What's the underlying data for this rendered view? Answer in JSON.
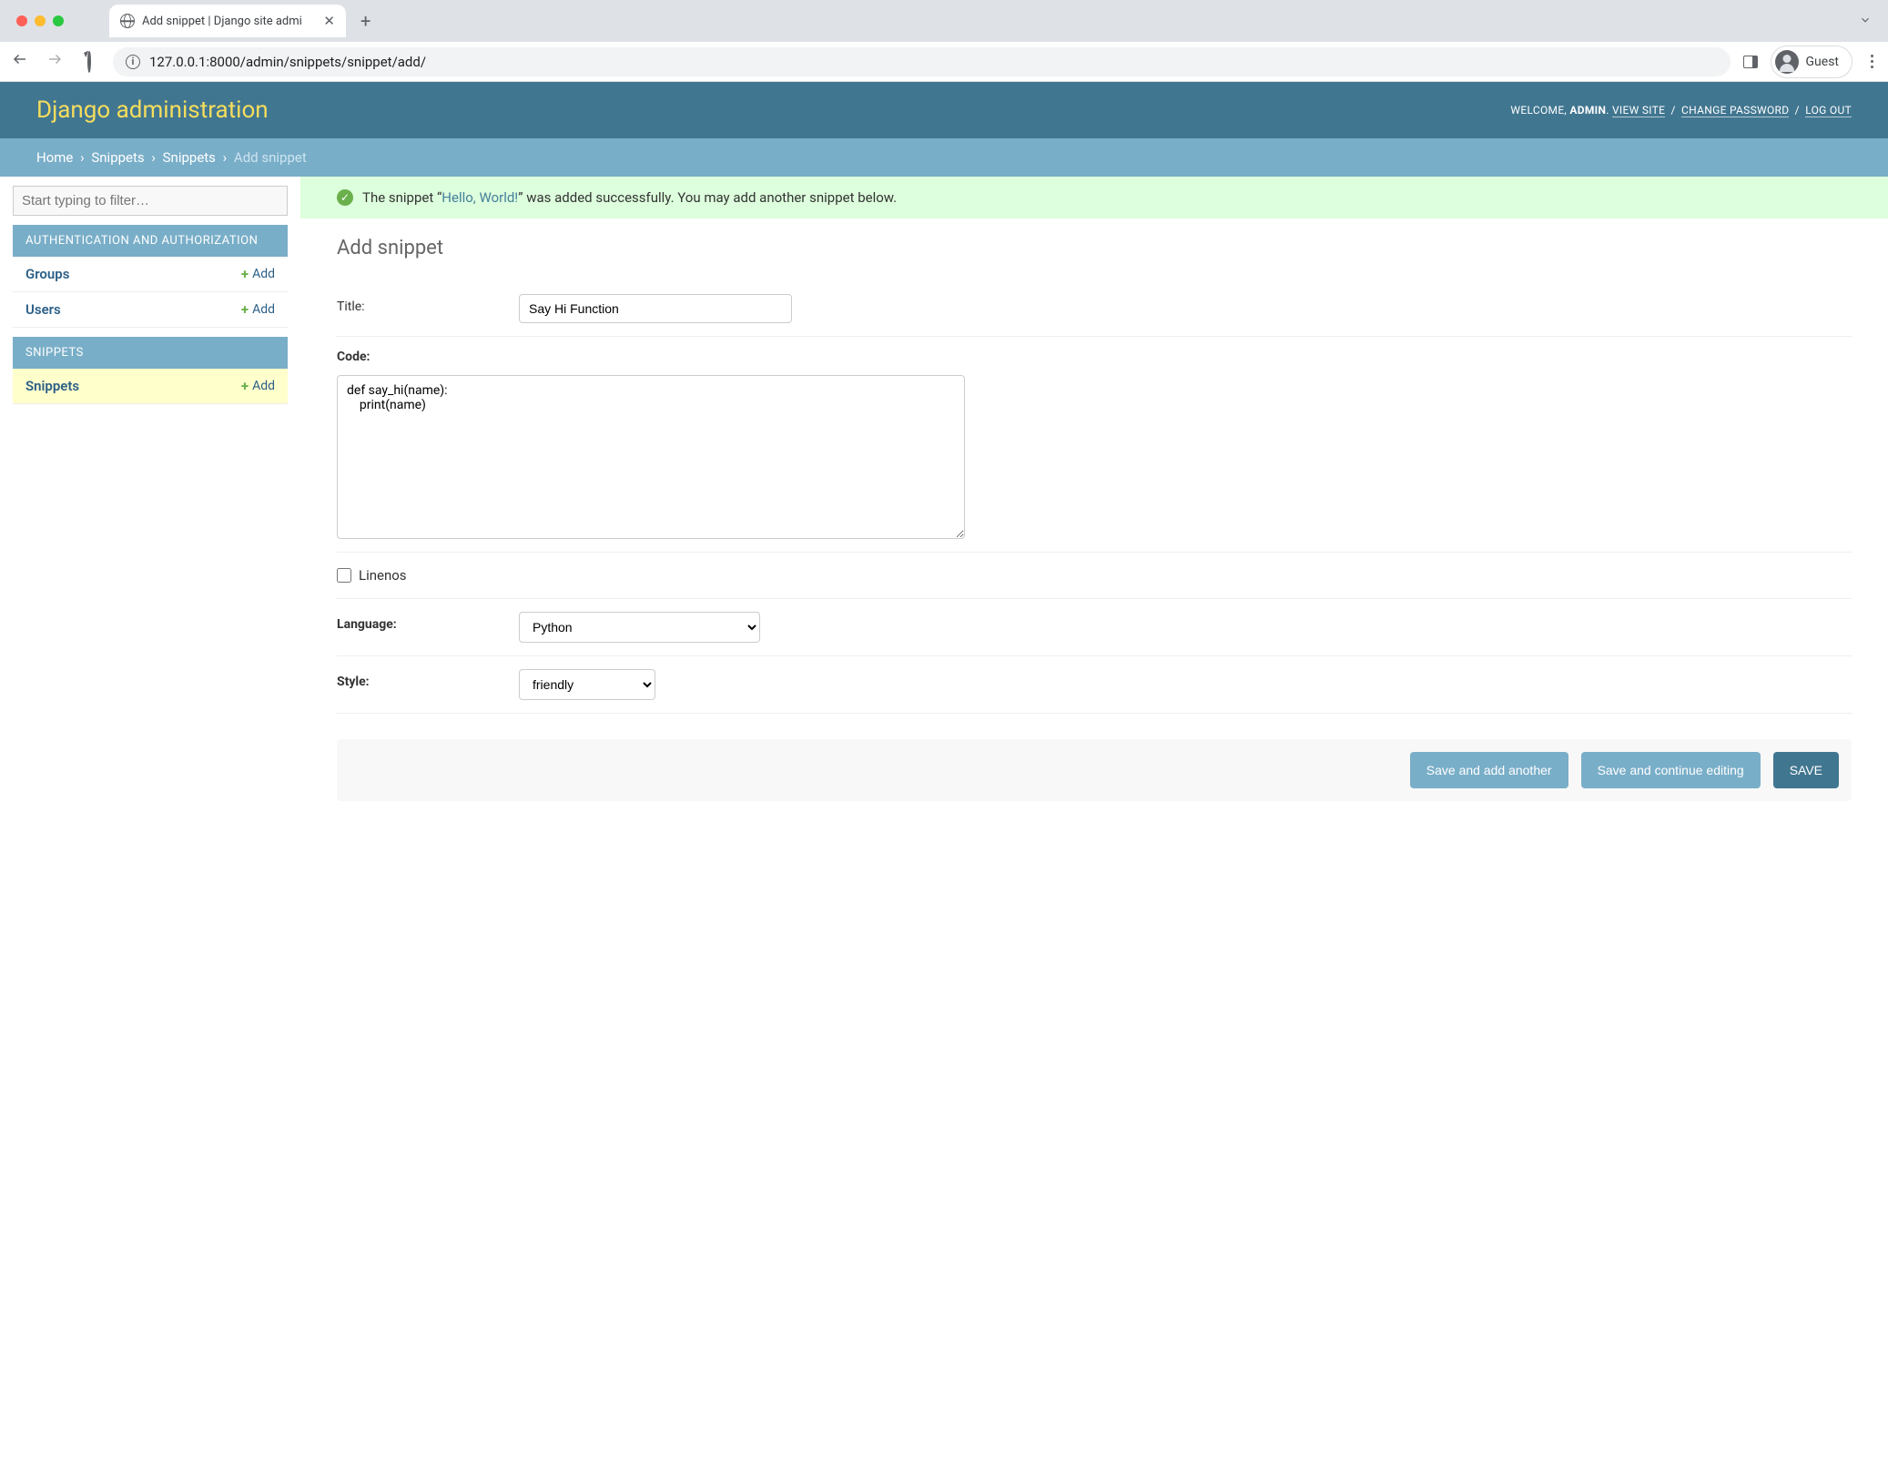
{
  "browser": {
    "tab_title": "Add snippet | Django site admi",
    "url": "127.0.0.1:8000/admin/snippets/snippet/add/",
    "guest_label": "Guest"
  },
  "header": {
    "branding": "Django administration",
    "welcome": "WELCOME, ",
    "user": "ADMIN",
    "view_site": "VIEW SITE",
    "change_password": "CHANGE PASSWORD",
    "log_out": "LOG OUT"
  },
  "breadcrumbs": {
    "home": "Home",
    "app": "Snippets",
    "model": "Snippets",
    "current": "Add snippet"
  },
  "sidebar": {
    "filter_placeholder": "Start typing to filter…",
    "apps": [
      {
        "caption": "AUTHENTICATION AND AUTHORIZATION",
        "models": [
          {
            "name": "Groups",
            "add": "Add"
          },
          {
            "name": "Users",
            "add": "Add"
          }
        ]
      },
      {
        "caption": "SNIPPETS",
        "models": [
          {
            "name": "Snippets",
            "add": "Add",
            "current": true
          }
        ]
      }
    ]
  },
  "message": {
    "prefix": "The snippet “",
    "link": "Hello, World!",
    "suffix": "” was added successfully. You may add another snippet below."
  },
  "page": {
    "title": "Add snippet"
  },
  "form": {
    "title_label": "Title:",
    "title_value": "Say Hi Function",
    "code_label": "Code:",
    "code_value": "def say_hi(name):\n    print(name)",
    "linenos_label": "Linenos",
    "language_label": "Language:",
    "language_value": "Python",
    "style_label": "Style:",
    "style_value": "friendly"
  },
  "buttons": {
    "save_add_another": "Save and add another",
    "save_continue": "Save and continue editing",
    "save": "SAVE"
  }
}
